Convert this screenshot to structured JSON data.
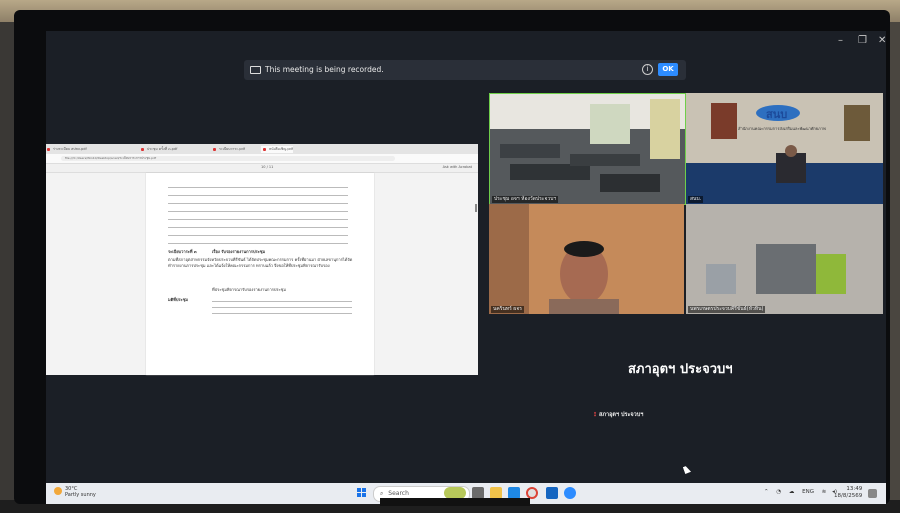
{
  "banner": {
    "text": "This meeting is being recorded.",
    "info": "i",
    "ok": "OK"
  },
  "window": {
    "minimize": "–",
    "maximize": "❐",
    "close": "✕"
  },
  "browser": {
    "tabs": [
      "ร่างระเบียบ สปชจ.pdf",
      "ประชุม ครั้งที่ ๓.pdf",
      "ระเบียบวาระ.pdf",
      "หนังสือเชิญ.pdf"
    ],
    "url": "file:///C:/Users/Win10/Desktop/scwd/ระเบียบวาระการประชุม.pdf",
    "page": "10 / 11",
    "ai": "Ask with Acrobat"
  },
  "document": {
    "agenda": "ระเบียบวาระที่ ๓",
    "subject": "เรื่อง รับรองรายงานการประชุม",
    "body": "ตามที่สภาอุตสาหกรรมจังหวัดประจวบคีรีขันธ์ ได้จัดประชุมคณะกรรมการ ครั้งที่ผ่านมา ฝ่ายเลขานุการได้จัดทำรายงานการประชุม และได้แจ้งให้คณะกรรมการ ทราบแล้ว จึงขอให้ที่ประชุมพิจารณารับรอง",
    "note": "ที่ประชุมพิจารณารับรองรายงานการประชุม",
    "resolution": "มติที่ประชุม"
  },
  "participants": [
    {
      "label": "ประชุม อจฯ ห้องวัดประจวบฯ"
    },
    {
      "label": "สนบ.",
      "sign": "สนบ",
      "subtitle": "สำนักงานคณะกรรมการส่งเสริมและพัฒนาศักยภาพ"
    },
    {
      "label": "นครินทร์ ผจร"
    },
    {
      "label": "นพรเกษตรประจวบคีรีขันธ์(หัวหิน)"
    }
  ],
  "active_speaker": {
    "name": "สภาอุตฯ ประจวบฯ",
    "small": "สภาอุตฯ ประจวบฯ"
  },
  "taskbar": {
    "temp": "30°C",
    "weather": "Partly sunny",
    "search": "Search",
    "lang": "ENG",
    "time": "13:49",
    "date": "18/8/2569"
  },
  "colors": {
    "accent": "#2d8cff",
    "active_border": "#6fcf4a"
  }
}
